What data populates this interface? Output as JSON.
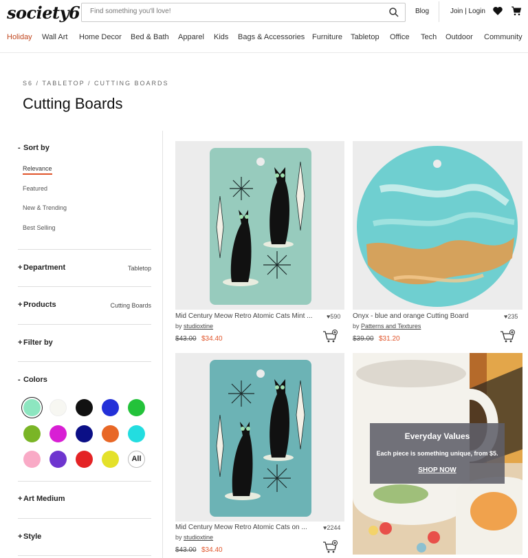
{
  "header": {
    "logo": "society6",
    "search_placeholder": "Find something you'll love!",
    "blog": "Blog",
    "join_login": "Join | Login"
  },
  "nav": [
    "Holiday",
    "Wall Art",
    "Home Decor",
    "Bed & Bath",
    "Apparel",
    "Kids",
    "Bags & Accessories",
    "Furniture",
    "Tabletop",
    "Office",
    "Tech",
    "Outdoor",
    "Community"
  ],
  "breadcrumb": [
    "S6",
    "/",
    "TABLETOP",
    "/",
    "CUTTING BOARDS"
  ],
  "page_title": "Cutting Boards",
  "sidebar": {
    "sort_title": "Sort by",
    "sort_options": [
      "Relevance",
      "Featured",
      "New & Trending",
      "Best Selling"
    ],
    "department": {
      "label": "Department",
      "value": "Tabletop"
    },
    "products": {
      "label": "Products",
      "value": "Cutting Boards"
    },
    "filter": "Filter by",
    "colors_title": "Colors",
    "colors": [
      "#8de6c0",
      "#f7f7f2",
      "#111111",
      "#2330d8",
      "#23c23a",
      "#7ab526",
      "#d81fd4",
      "#0b0f86",
      "#e86726",
      "#23dde0",
      "#f9aac6",
      "#6e35cf",
      "#e42325",
      "#e4e12a"
    ],
    "all_label": "All",
    "art_medium": "Art Medium",
    "style": "Style"
  },
  "products": [
    {
      "title": "Mid Century Meow Retro Atomic Cats Mint ...",
      "likes": "590",
      "by": "by",
      "artist": "studioxtine",
      "old_price": "$43.00",
      "new_price": "$34.40"
    },
    {
      "title": "Onyx - blue and orange Cutting Board",
      "likes": "235",
      "by": "by",
      "artist": "Patterns and Textures",
      "old_price": "$39.00",
      "new_price": "$31.20"
    },
    {
      "title": "Mid Century Meow Retro Atomic Cats on ...",
      "likes": "2244",
      "by": "by",
      "artist": "studioxtine",
      "old_price": "$43.00",
      "new_price": "$34.40"
    }
  ],
  "promo": {
    "title": "Everyday Values",
    "subtitle": "Each piece is something unique, from $5.",
    "link": "SHOP NOW"
  },
  "colors": {
    "accent": "#e0542a",
    "nav_active": "#c0461e"
  }
}
